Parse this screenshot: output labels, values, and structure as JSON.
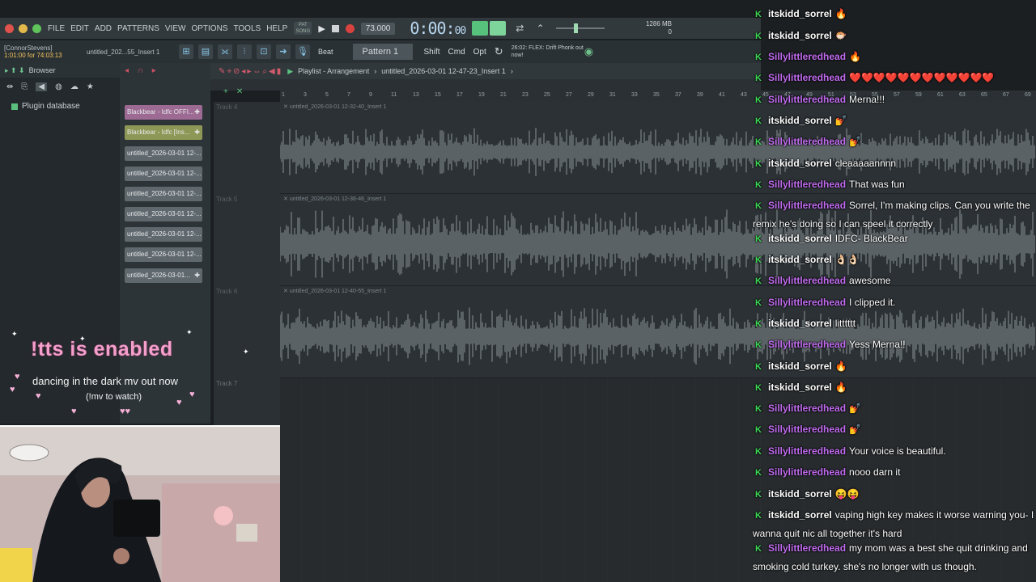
{
  "menubar": {
    "items": [
      "FILE",
      "EDIT",
      "ADD",
      "PATTERNS",
      "VIEW",
      "OPTIONS",
      "TOOLS",
      "HELP"
    ],
    "song_label": "PAT SONG",
    "tempo": "73.000",
    "time_main": "0:00:",
    "time_small": "00",
    "memory": "1286 MB",
    "memory_sub": "0"
  },
  "toolbar2": {
    "hint_user": "[ConnorStevens]",
    "hint_time": "1:01:00 for 74:03:13",
    "file_title": "untitled_202...55_Insert 1",
    "beat_label": "Beat",
    "pattern": "Pattern 1",
    "mod_keys": [
      "Shift",
      "Cmd",
      "Opt"
    ],
    "news": "26:02: FLEX: Drift Phonk out now!"
  },
  "browser": {
    "title": "Browser",
    "item": "Plugin database"
  },
  "channels": [
    {
      "label": "Blackbear - Idfc OFFI...",
      "color": "pink"
    },
    {
      "label": "Blackbear - Idfc [Ins...",
      "color": "olive"
    },
    {
      "label": "untitled_2026-03-01 12-...",
      "color": "gray"
    },
    {
      "label": "untitled_2026-03-01 12-...",
      "color": "gray"
    },
    {
      "label": "untitled_2026-03-01 12-...",
      "color": "gray"
    },
    {
      "label": "untitled_2026-03-01 12-...",
      "color": "gray"
    },
    {
      "label": "untitled_2026-03-01 12-...",
      "color": "gray"
    },
    {
      "label": "untitled_2026-03-01 12-...",
      "color": "gray"
    },
    {
      "label": "untitled_2026-03-01...",
      "color": "gray"
    }
  ],
  "playlist": {
    "title": "Playlist - Arrangement",
    "subtitle": "untitled_2026-03-01 12-47-23_Insert 1",
    "ruler": [
      "1",
      "3",
      "5",
      "7",
      "9",
      "11",
      "13",
      "15",
      "17",
      "19",
      "21",
      "23",
      "25",
      "27",
      "29",
      "31",
      "33",
      "35",
      "37",
      "39",
      "41",
      "43",
      "45",
      "47",
      "49",
      "51",
      "53",
      "55",
      "57",
      "59",
      "61",
      "63",
      "65",
      "67",
      "69"
    ],
    "tracks": [
      {
        "label": "Track 4",
        "clip": "untitled_2026-03-01 12-32-40_Insert 1"
      },
      {
        "label": "Track 5",
        "clip": "untitled_2026-03-01 12-36-46_Insert 1"
      },
      {
        "label": "Track 6",
        "clip": "untitled_2026-03-01 12-40-55_Insert 1"
      },
      {
        "label": "Track 7",
        "clip": ""
      }
    ]
  },
  "overlay": {
    "tts": "!tts is enabled",
    "mv": "dancing in the dark mv out now",
    "cmd": "(!mv to watch)"
  },
  "chat": [
    {
      "user": "itskidd_sorrel",
      "text": "🔥",
      "style": "its"
    },
    {
      "user": "itskidd_sorrel",
      "text": "🐡",
      "style": "its"
    },
    {
      "user": "Sillylittleredhead",
      "text": "🔥",
      "style": "silly"
    },
    {
      "user": "Sillylittleredhead",
      "text": "❤️❤️❤️❤️❤️❤️❤️❤️❤️❤️❤️❤️",
      "style": "silly"
    },
    {
      "user": "Sillylittleredhead",
      "text": "Merna!!!",
      "style": "silly"
    },
    {
      "user": "itskidd_sorrel",
      "text": "💅",
      "style": "its"
    },
    {
      "user": "Sillylittleredhead",
      "text": "💅",
      "style": "silly"
    },
    {
      "user": "itskidd_sorrel",
      "text": "cleaaaaannnn",
      "style": "its"
    },
    {
      "user": "Sillylittleredhead",
      "text": "That was fun",
      "style": "silly"
    },
    {
      "user": "Sillylittleredhead",
      "text": "Sorrel, I'm making clips. Can you write the remix he's doing so I can speel it correctly",
      "style": "silly"
    },
    {
      "user": "itskidd_sorrel",
      "text": "IDFC- BlackBear",
      "style": "its"
    },
    {
      "user": "itskidd_sorrel",
      "text": "👌🏻👌🏻",
      "style": "its"
    },
    {
      "user": "Sillylittleredhead",
      "text": "awesome",
      "style": "silly"
    },
    {
      "user": "Sillylittleredhead",
      "text": "I clipped it.",
      "style": "silly"
    },
    {
      "user": "itskidd_sorrel",
      "text": "litttttt",
      "style": "its"
    },
    {
      "user": "Sillylittleredhead",
      "text": "Yess Merna!!",
      "style": "silly"
    },
    {
      "user": "itskidd_sorrel",
      "text": "🔥",
      "style": "its"
    },
    {
      "user": "itskidd_sorrel",
      "text": "🔥",
      "style": "its"
    },
    {
      "user": "Sillylittleredhead",
      "text": "💅",
      "style": "silly"
    },
    {
      "user": "Sillylittleredhead",
      "text": "💅",
      "style": "silly"
    },
    {
      "user": "Sillylittleredhead",
      "text": "Your voice is beautiful.",
      "style": "silly"
    },
    {
      "user": "Sillylittleredhead",
      "text": "nooo darn it",
      "style": "silly"
    },
    {
      "user": "itskidd_sorrel",
      "text": "😝😝",
      "style": "its"
    },
    {
      "user": "itskidd_sorrel",
      "text": "vaping high key makes it worse warning you- I wanna quit nic all together it's hard",
      "style": "its"
    },
    {
      "user": "Sillylittleredhead",
      "text": "my mom was a best she quit drinking and smoking cold turkey. she's no longer with us though.",
      "style": "silly"
    }
  ],
  "colors": {
    "accent_green": "#57c27b",
    "chat_silly": "#c16cf0",
    "tts_pink": "#f49fcc",
    "record_red": "#d9433f"
  }
}
